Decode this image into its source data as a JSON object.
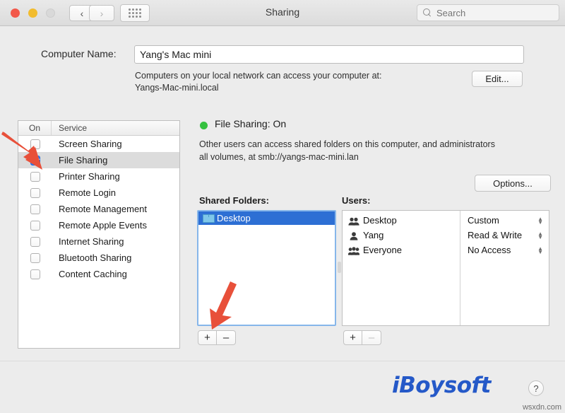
{
  "window": {
    "title": "Sharing",
    "traffic_lights": [
      "close",
      "minimize",
      "zoom"
    ],
    "back_glyph": "‹",
    "forward_glyph": "›",
    "grid_button": "show-all-preferences"
  },
  "search": {
    "placeholder": "Search",
    "value": "",
    "icon": "search-icon"
  },
  "computer_name": {
    "label": "Computer Name:",
    "value": "Yang's Mac mini",
    "note_line1": "Computers on your local network can access your computer at:",
    "note_line2": "Yangs-Mac-mini.local",
    "edit_button": "Edit..."
  },
  "services_table": {
    "headers": {
      "on": "On",
      "service": "Service"
    },
    "rows": [
      {
        "name": "Screen Sharing",
        "on": false,
        "selected": false
      },
      {
        "name": "File Sharing",
        "on": true,
        "selected": true
      },
      {
        "name": "Printer Sharing",
        "on": false,
        "selected": false
      },
      {
        "name": "Remote Login",
        "on": false,
        "selected": false
      },
      {
        "name": "Remote Management",
        "on": false,
        "selected": false
      },
      {
        "name": "Remote Apple Events",
        "on": false,
        "selected": false
      },
      {
        "name": "Internet Sharing",
        "on": false,
        "selected": false
      },
      {
        "name": "Bluetooth Sharing",
        "on": false,
        "selected": false
      },
      {
        "name": "Content Caching",
        "on": false,
        "selected": false
      }
    ]
  },
  "detail": {
    "status_title": "File Sharing: On",
    "status_color": "#35c13f",
    "description_line1": "Other users can access shared folders on this computer, and administrators",
    "description_line2": "all volumes, at smb://yangs-mac-mini.lan",
    "options_button": "Options..."
  },
  "shared_folders": {
    "label": "Shared Folders:",
    "items": [
      {
        "name": "Desktop",
        "selected": true,
        "icon": "folder-icon"
      }
    ],
    "add_button": "+",
    "remove_button": "–",
    "add_enabled": true,
    "remove_enabled": true
  },
  "users": {
    "label": "Users:",
    "rows": [
      {
        "name": "Desktop",
        "icon": "group-icon",
        "permission": "Custom"
      },
      {
        "name": "Yang",
        "icon": "person-icon",
        "permission": "Read & Write"
      },
      {
        "name": "Everyone",
        "icon": "everyone-icon",
        "permission": "No Access"
      }
    ],
    "add_button": "+",
    "remove_button": "–",
    "add_enabled": true,
    "remove_enabled": false
  },
  "footer": {
    "brand": "iBoysoft",
    "brand_color": "#2559c8",
    "help_button": "?",
    "watermark": "wsxdn.com"
  },
  "annotations": {
    "arrow_color": "#e8503a",
    "arrow1_target": "file-sharing-checkbox",
    "arrow2_target": "add-shared-folder-button"
  }
}
